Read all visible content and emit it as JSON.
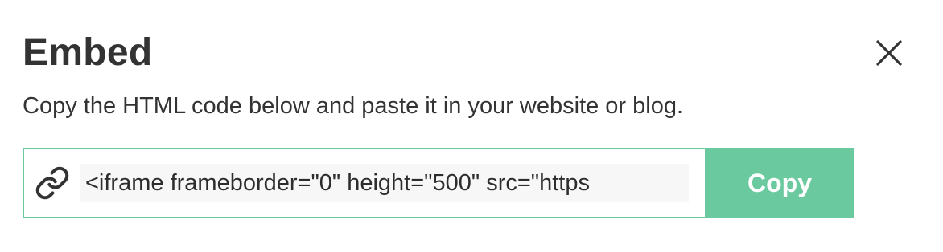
{
  "dialog": {
    "title": "Embed",
    "description": "Copy the HTML code below and paste it in your website or blog.",
    "close_icon": "close-icon"
  },
  "embed": {
    "link_icon": "link-icon",
    "code_value": "<iframe frameborder=\"0\" height=\"500\" src=\"https",
    "copy_label": "Copy"
  },
  "colors": {
    "accent": "#6ac99e",
    "text": "#333333",
    "input_bg": "#f7f7f7"
  }
}
